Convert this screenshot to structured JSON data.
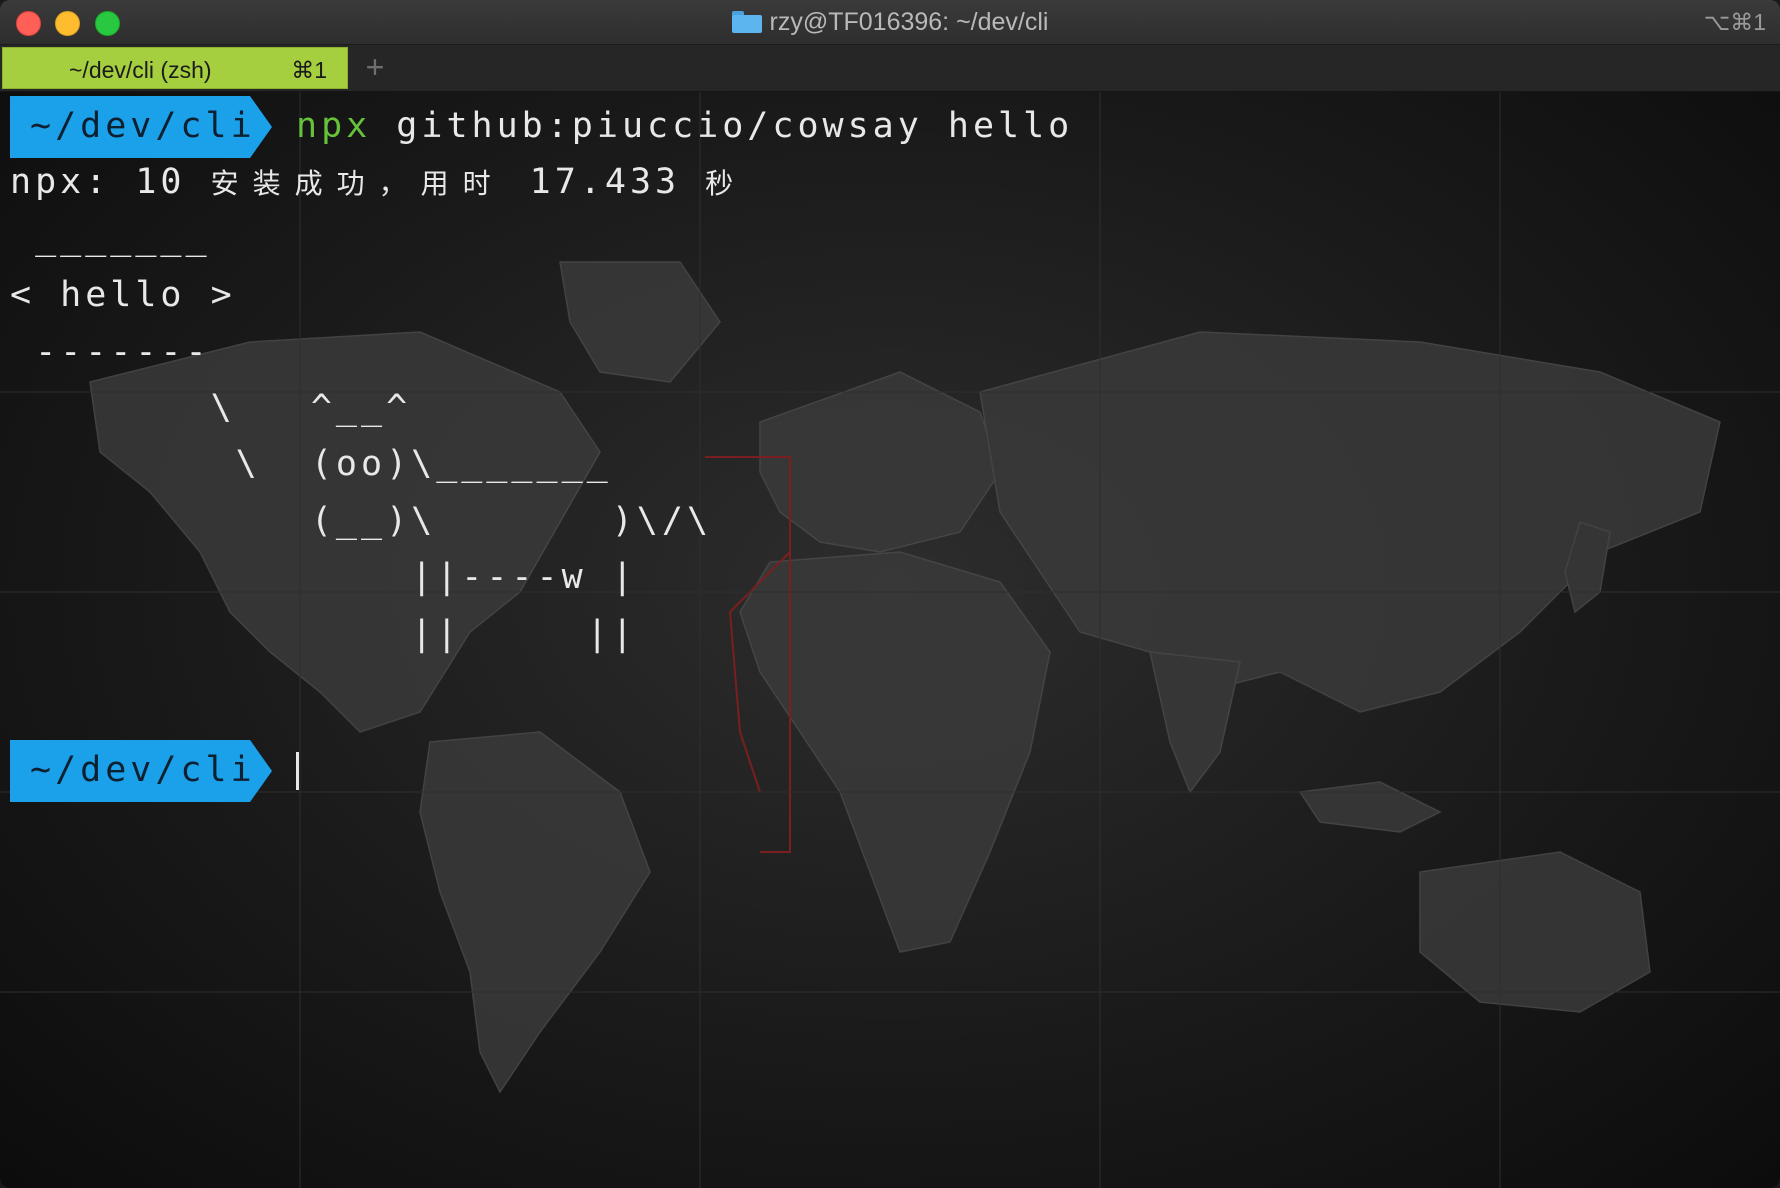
{
  "window": {
    "title": "rzy@TF016396: ~/dev/cli",
    "shortcut": "⌥⌘1"
  },
  "tabs": [
    {
      "label": "~/dev/cli (zsh)",
      "shortcut": "⌘1",
      "active": true
    }
  ],
  "new_tab_symbol": "+",
  "terminal": {
    "prompt_path": "~/dev/cli",
    "command_name": "npx",
    "command_args": "github:piuccio/cowsay hello",
    "output_npx_prefix": "npx: 10 ",
    "output_npx_cjk1": "安装成功，用时",
    "output_npx_time": " 17.433 ",
    "output_npx_cjk2": "秒",
    "cowsay_lines": [
      " _______",
      "< hello >",
      " -------",
      "        \\   ^__^",
      "         \\  (oo)\\_______",
      "            (__)\\       )\\/\\",
      "                ||----w |",
      "                ||     ||"
    ],
    "second_prompt_path": "~/dev/cli"
  },
  "colors": {
    "prompt_bg": "#1aa1ea",
    "tab_active_bg": "#a6cf3f",
    "npx_green": "#65c23a",
    "text": "#e8e8e8"
  },
  "icons": {
    "title_icon": "folder-icon"
  }
}
